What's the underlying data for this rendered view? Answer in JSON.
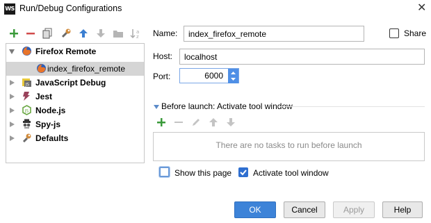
{
  "window": {
    "app_icon_text": "WS",
    "title": "Run/Debug Configurations"
  },
  "toolbar": {
    "icons": [
      "add-icon",
      "remove-icon",
      "copy-icon",
      "wrench-icon",
      "move-up-icon",
      "move-down-icon",
      "folder-icon",
      "sort-icon"
    ]
  },
  "tree": {
    "items": [
      {
        "label": "Firefox Remote",
        "bold": true,
        "expanded": true,
        "icon": "firefox-icon"
      },
      {
        "label": "index_firefox_remote",
        "bold": false,
        "selected": true,
        "icon": "firefox-icon"
      },
      {
        "label": "JavaScript Debug",
        "bold": true,
        "expanded": false,
        "icon": "javascript-debug-icon"
      },
      {
        "label": "Jest",
        "bold": true,
        "expanded": false,
        "icon": "jest-icon"
      },
      {
        "label": "Node.js",
        "bold": true,
        "expanded": false,
        "icon": "nodejs-icon"
      },
      {
        "label": "Spy-js",
        "bold": true,
        "expanded": false,
        "icon": "spy-js-icon"
      },
      {
        "label": "Defaults",
        "bold": true,
        "expanded": false,
        "icon": "wrench-icon"
      }
    ]
  },
  "form": {
    "name_label": "Name:",
    "name_value": "index_firefox_remote",
    "share_label": "Share",
    "host_label": "Host:",
    "host_value": "localhost",
    "port_label": "Port:",
    "port_value": "6000",
    "before_launch_label": "Before launch: Activate tool window",
    "tasks_empty_text": "There are no tasks to run before launch",
    "show_page_label": "Show this page",
    "activate_tool_label": "Activate tool window",
    "share_checked": false,
    "show_page_checked": false,
    "activate_tool_checked": true
  },
  "buttons": {
    "ok": "OK",
    "cancel": "Cancel",
    "apply": "Apply",
    "help": "Help"
  },
  "colors": {
    "accent": "#3d83d8",
    "add_green": "#3a9a3a",
    "remove_red": "#d24b4b",
    "selection": "#d5d5d5"
  }
}
